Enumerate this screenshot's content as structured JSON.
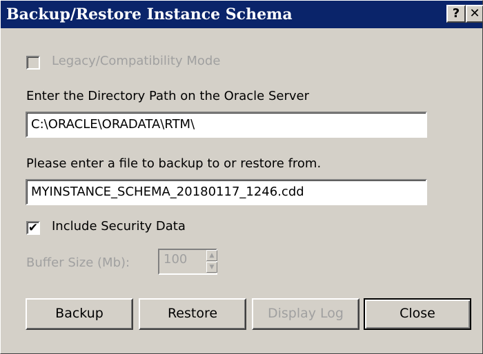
{
  "window": {
    "title": "Backup/Restore Instance Schema",
    "help_label": "?",
    "close_label": "✕"
  },
  "legacy": {
    "label": "Legacy/Compatibility Mode",
    "checked": false,
    "enabled": false
  },
  "directory": {
    "label": "Enter the Directory Path on the Oracle Server",
    "value": "C:\\ORACLE\\ORADATA\\RTM\\"
  },
  "file": {
    "label": "Please enter a file to backup to or restore from.",
    "value": "MYINSTANCE_SCHEMA_20180117_1246.cdd"
  },
  "security": {
    "label": "Include Security Data",
    "checked": true,
    "mark": "✔"
  },
  "buffer": {
    "label": "Buffer Size (Mb):",
    "value": "100",
    "up_glyph": "▲",
    "down_glyph": "▼"
  },
  "buttons": {
    "backup": "Backup",
    "restore": "Restore",
    "display_log": "Display Log",
    "close": "Close"
  },
  "colors": {
    "titlebar": "#0a246a",
    "face": "#d4d0c8",
    "disabled_text": "#a0a0a0"
  }
}
